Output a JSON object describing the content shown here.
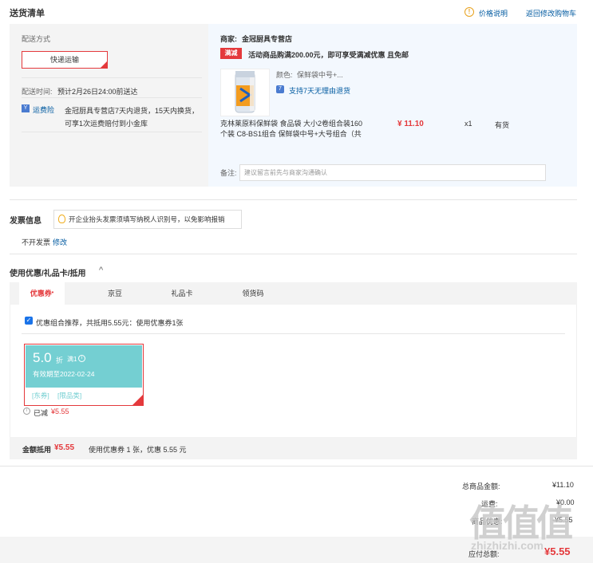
{
  "header": {
    "title": "送货清单",
    "price_help": "价格说明",
    "back_to_cart": "返回修改购物车"
  },
  "shipping": {
    "method_label": "配送方式",
    "method_button": "快递运输",
    "time_label": "配送时间:",
    "time_value": "预计2月26日24:00前送达",
    "freight_badge": "运费险",
    "freight_text_1": "金冠厨具专营店7天内退货，15天内换货，",
    "freight_text_2": "可享1次运费赔付到小金库"
  },
  "store": {
    "label": "商家:",
    "name": "金冠厨具专营店",
    "promo_tag": "满减",
    "promo_text": "活动商品购满200.00元，即可享受满减优惠 且免邮"
  },
  "product": {
    "color_label": "颜色:",
    "color_value": "保鲜袋中号+...",
    "support_text": "支持7天无理由退货",
    "name_1": "克林莱原料保鲜袋 食品袋 大小2卷组合装160",
    "name_2": "个装 C8-BS1组合 保鲜袋中号+大号组合（共",
    "price": "¥ 11.10",
    "qty": "x1",
    "stock": "有货"
  },
  "note": {
    "label": "备注:",
    "placeholder": "建议留言前先与商家沟通确认"
  },
  "invoice": {
    "title": "发票信息",
    "tip": "开企业抬头发票须填写纳税人识别号，以免影响报销",
    "value": "不开发票",
    "edit": "修改"
  },
  "coupons": {
    "title": "使用优惠/礼品卡/抵用",
    "tabs": [
      "优惠券",
      "京豆",
      "礼品卡",
      "领货码"
    ],
    "recommend_text": "优惠组合推荐，共抵用5.55元：使用优惠券1张",
    "card": {
      "value": "5.0",
      "unit": "折",
      "cond": "满1",
      "expiry": "有效期至2022-02-24",
      "tag1": "[东券]",
      "tag2": "[限品类]",
      "saved_label": "已减",
      "saved_amount": "¥5.55"
    },
    "total_label": "金额抵用",
    "total_amount": "¥5.55",
    "total_detail": "使用优惠券 1 张，优惠 5.55 元"
  },
  "summary": {
    "goods_label": "总商品金额:",
    "goods_amount": "¥11.10",
    "freight_label": "运费:",
    "freight_amount": "¥0.00",
    "discount_label": "商品优惠:",
    "discount_amount": "-¥5.55",
    "payable_label": "应付总额:",
    "payable_amount": "¥5.55"
  },
  "watermark": {
    "logo": "值值值",
    "url": "zhizhizhi.com"
  },
  "colors": {
    "accent_red": "#e4393c",
    "link_blue": "#005aa0",
    "coupon_teal": "#74cfd2"
  }
}
